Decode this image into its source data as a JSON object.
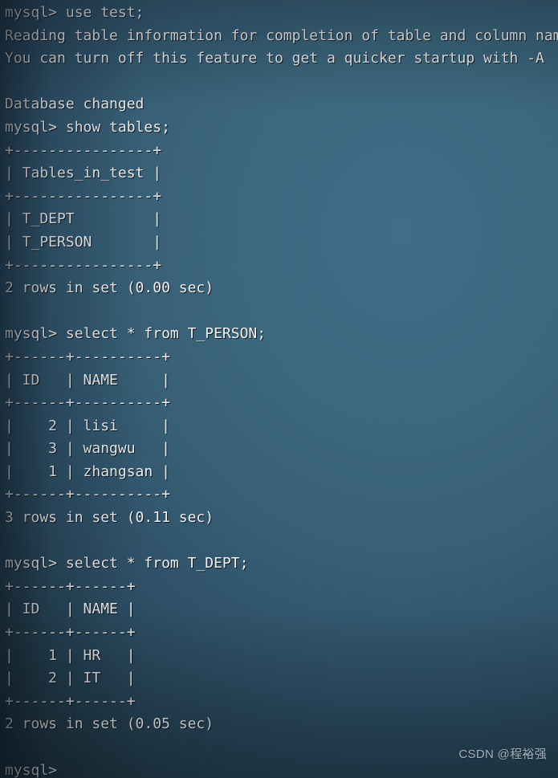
{
  "terminal": {
    "prompt": "mysql>",
    "colors": {
      "foreground": "#f2f2f2",
      "background_bright": "#416d88",
      "background_dark": "#16222d",
      "watermark": "#b9c4cc"
    },
    "lines": [
      "mysql> use test;",
      "Reading table information for completion of table and column names",
      "You can turn off this feature to get a quicker startup with -A",
      "",
      "Database changed",
      "mysql> show tables;",
      "+----------------+",
      "| Tables_in_test |",
      "+----------------+",
      "| T_DEPT         |",
      "| T_PERSON       |",
      "+----------------+",
      "2 rows in set (0.00 sec)",
      "",
      "mysql> select * from T_PERSON;",
      "+------+----------+",
      "| ID   | NAME     |",
      "+------+----------+",
      "|    2 | lisi     |",
      "|    3 | wangwu   |",
      "|    1 | zhangsan |",
      "+------+----------+",
      "3 rows in set (0.11 sec)",
      "",
      "mysql> select * from T_DEPT;",
      "+------+------+",
      "| ID   | NAME |",
      "+------+------+",
      "|    1 | HR   |",
      "|    2 | IT   |",
      "+------+------+",
      "2 rows in set (0.05 sec)",
      "",
      "mysql>"
    ],
    "commands": [
      "use test;",
      "show tables;",
      "select * from T_PERSON;",
      "select * from T_DEPT;"
    ],
    "messages": [
      "Reading table information for completion of table and column names",
      "You can turn off this feature to get a quicker startup with -A",
      "Database changed"
    ],
    "result_sets": [
      {
        "query": "show tables;",
        "columns": [
          "Tables_in_test"
        ],
        "rows": [
          [
            "T_DEPT"
          ],
          [
            "T_PERSON"
          ]
        ],
        "status": "2 rows in set (0.00 sec)"
      },
      {
        "query": "select * from T_PERSON;",
        "columns": [
          "ID",
          "NAME"
        ],
        "rows": [
          [
            "2",
            "lisi"
          ],
          [
            "3",
            "wangwu"
          ],
          [
            "1",
            "zhangsan"
          ]
        ],
        "status": "3 rows in set (0.11 sec)"
      },
      {
        "query": "select * from T_DEPT;",
        "columns": [
          "ID",
          "NAME"
        ],
        "rows": [
          [
            "1",
            "HR"
          ],
          [
            "2",
            "IT"
          ]
        ],
        "status": "2 rows in set (0.05 sec)"
      }
    ]
  },
  "watermark": {
    "text": "CSDN @程裕强"
  }
}
